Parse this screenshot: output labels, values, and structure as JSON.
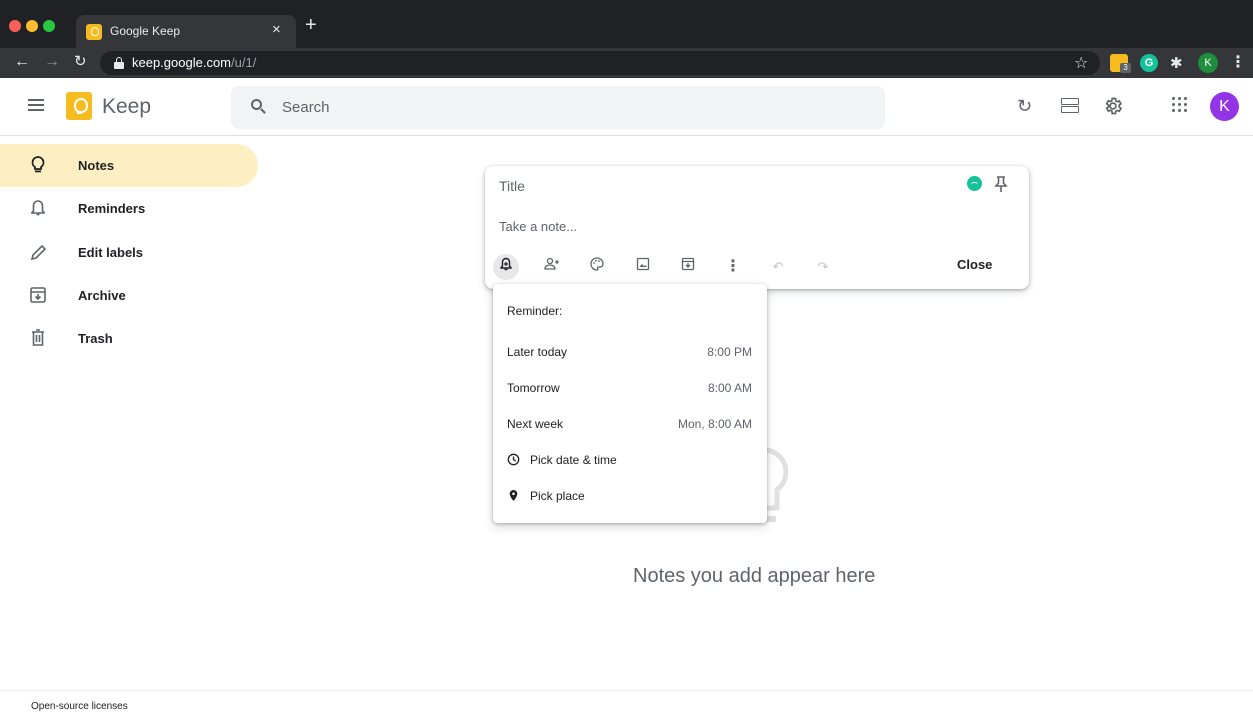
{
  "browser": {
    "tab_title": "Google Keep",
    "tab_close": "×",
    "new_tab": "+",
    "url_host": "keep.google.com",
    "url_path": "/u/1/",
    "ext_badge": "3",
    "ext_grammarly": "G",
    "profile_initial": "K"
  },
  "app": {
    "brand": "Keep",
    "search_placeholder": "Search",
    "avatar_initial": "K",
    "avatar_color": "#9334e6",
    "accent_color": "#feefc3"
  },
  "sidebar": {
    "items": [
      {
        "label": "Notes",
        "icon": "lightbulb-icon",
        "active": true
      },
      {
        "label": "Reminders",
        "icon": "bell-icon",
        "active": false
      },
      {
        "label": "Edit labels",
        "icon": "pencil-icon",
        "active": false
      },
      {
        "label": "Archive",
        "icon": "archive-icon",
        "active": false
      },
      {
        "label": "Trash",
        "icon": "trash-icon",
        "active": false
      }
    ]
  },
  "editor": {
    "title_placeholder": "Title",
    "body_placeholder": "Take a note...",
    "close_label": "Close",
    "tools": [
      "remind-me-icon",
      "collaborator-icon",
      "palette-icon",
      "image-icon",
      "archive-icon",
      "more-icon",
      "undo-icon",
      "redo-icon"
    ]
  },
  "reminder_menu": {
    "heading": "Reminder:",
    "options": [
      {
        "label": "Later today",
        "time": "8:00 PM"
      },
      {
        "label": "Tomorrow",
        "time": "8:00 AM"
      },
      {
        "label": "Next week",
        "time": "Mon, 8:00 AM"
      }
    ],
    "pick_date": "Pick date & time",
    "pick_place": "Pick place"
  },
  "empty_state": {
    "message": "Notes you add appear here"
  },
  "footer": {
    "link": "Open-source licenses"
  }
}
